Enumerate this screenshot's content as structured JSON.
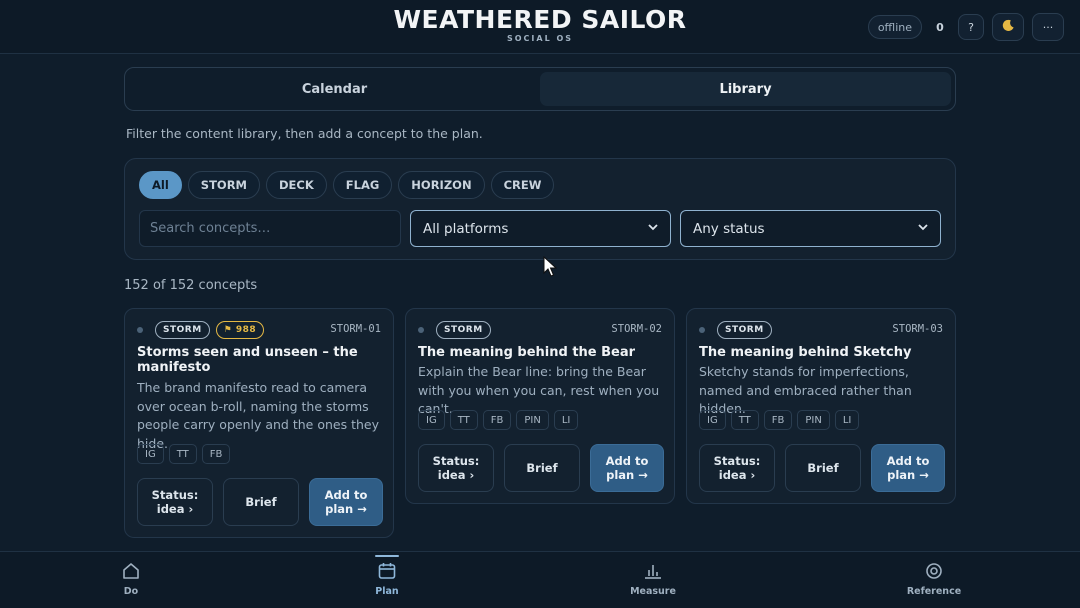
{
  "header": {
    "brand_title": "WEATHERED SAILOR",
    "brand_sub": "SOCIAL OS",
    "status": "offline",
    "counter": "0",
    "help_label": "?",
    "theme_icon": "moon-icon",
    "more_label": "···"
  },
  "tabs": [
    {
      "label": "Calendar",
      "active": false
    },
    {
      "label": "Library",
      "active": true
    }
  ],
  "hint": "Filter the content library, then add a concept to the plan.",
  "filters": {
    "chips": [
      "All",
      "STORM",
      "DECK",
      "FLAG",
      "HORIZON",
      "CREW"
    ],
    "active_chip": "All",
    "search_placeholder": "Search concepts…",
    "platform_select": "All platforms",
    "status_select": "Any status"
  },
  "count": "152 of 152 concepts",
  "cards": [
    {
      "tag": "STORM",
      "badge": "⚑ 988",
      "code": "STORM-01",
      "title": "Storms seen and unseen – the manifesto",
      "description": "The brand manifesto read to camera over ocean b-roll, naming the storms people carry openly and the ones they hide.",
      "platforms": [
        "IG",
        "TT",
        "FB"
      ],
      "status_btn": "Status: idea ›",
      "brief_btn": "Brief",
      "add_btn": "Add to plan →"
    },
    {
      "tag": "STORM",
      "code": "STORM-02",
      "title": "The meaning behind the Bear",
      "description": "Explain the Bear line: bring the Bear with you when you can, rest when you can't.",
      "platforms": [
        "IG",
        "TT",
        "FB",
        "PIN",
        "LI"
      ],
      "status_btn": "Status: idea ›",
      "brief_btn": "Brief",
      "add_btn": "Add to plan →"
    },
    {
      "tag": "STORM",
      "code": "STORM-03",
      "title": "The meaning behind Sketchy",
      "description": "Sketchy stands for imperfections, named and embraced rather than hidden.",
      "platforms": [
        "IG",
        "TT",
        "FB",
        "PIN",
        "LI"
      ],
      "status_btn": "Status: idea ›",
      "brief_btn": "Brief",
      "add_btn": "Add to plan →"
    }
  ],
  "bottom_nav": [
    {
      "label": "Do",
      "icon": "home-icon"
    },
    {
      "label": "Plan",
      "icon": "calendar-icon",
      "active": true
    },
    {
      "label": "Measure",
      "icon": "bar-chart-icon"
    },
    {
      "label": "Reference",
      "icon": "target-icon"
    }
  ],
  "colors": {
    "background": "#0f1d2b",
    "accent": "#5b97c7",
    "primary_button": "#2f5d86",
    "badge_gold": "#e5b844"
  }
}
